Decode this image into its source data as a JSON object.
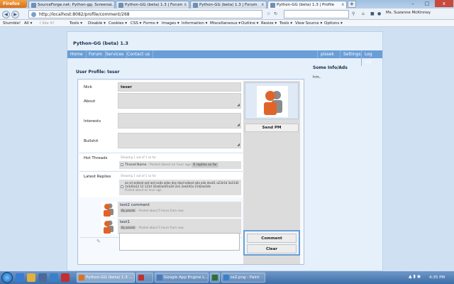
{
  "browser": {
    "app_button": "Firefox",
    "tabs": [
      {
        "label": "SourceForge.net: Python-gg: Screens..."
      },
      {
        "label": "Python-GG (beta) 1.3 | Forum"
      },
      {
        "label": "Python-GG (beta) 1.3 | Forum"
      },
      {
        "label": "Python-GG (beta) 1.3 | Profile"
      }
    ],
    "new_tab": "+",
    "window_controls": {
      "minimize": "–",
      "maximize": "□",
      "close": "x"
    },
    "url": "http://localhost:8082/profile/comment/268",
    "user": "Ms. Suzanne McKinney",
    "bookmarks": [
      {
        "label": "Stumble!"
      },
      {
        "label": "All ▾"
      },
      {
        "label": "I like it!",
        "dim": true
      },
      {
        "label": "Tools ▾"
      },
      {
        "label": "Disable ▾"
      },
      {
        "label": "Cookies ▾"
      },
      {
        "label": "CSS ▾"
      },
      {
        "label": "Forms ▾"
      },
      {
        "label": "Images ▾"
      },
      {
        "label": "Information ▾"
      },
      {
        "label": "Miscellaneous ▾"
      },
      {
        "label": "Outline ▾"
      },
      {
        "label": "Resize ▾"
      },
      {
        "label": "Tools ▾"
      },
      {
        "label": "View Source ▾"
      },
      {
        "label": "Options ▾"
      }
    ]
  },
  "site": {
    "title": "Python-GG (beta) 1.3",
    "nav_left": [
      "Home",
      "Forum",
      "Services",
      "Contact us"
    ],
    "nav_right": [
      "pissek",
      "Settings",
      "Log out"
    ]
  },
  "profile": {
    "heading": "User Profile: teser",
    "nick_label": "Nick",
    "nick_value": "teser",
    "about_label": "About",
    "interests_label": "Interests",
    "bullshit_label": "Bullshit",
    "hot_threads_label": "Hot Threads",
    "hot_threads_meta": "Showing 1 out of 1 so far",
    "thread_name": "Thread Name",
    "thread_posted": "- Posted about an hour ago",
    "thread_replies": "0 replies so far",
    "latest_replies_label": "Latest Replies",
    "latest_replies_meta": "Showing 1 out of 1 so far",
    "reply_text": "ao sd asdasd asd asd asda adas das dasd adasd ada ada dasd1 a23e1d 3a21d2 1a1d2a12 12 121d 32ad2ad21a2d 2a1 2ae2d1a 21d2ae2de",
    "reply_posted": "Posted about an hour ago",
    "comments": [
      {
        "title": "test2 comment",
        "by": "By pissek",
        "posted": "- Posted about 5 hours from now"
      },
      {
        "title": "test1",
        "by": "By pissek",
        "posted": "- Posted about 5 hours from now"
      }
    ],
    "send_pm": "Send PM",
    "comment_button": "Comment",
    "clear_button": "Clear"
  },
  "sidebar": {
    "heading": "Some Info/Ads",
    "text": "hm.."
  },
  "taskbar": {
    "tasks": [
      {
        "label": "Python-GG (beta) 1.3 ...",
        "color": "#e07020",
        "active": true
      },
      {
        "label": "",
        "color": "#c03030",
        "active": false
      },
      {
        "label": "Google App Engine L...",
        "color": "#4a7ab8",
        "active": false
      },
      {
        "label": "",
        "color": "#2f6f2f",
        "active": false
      },
      {
        "label": "ss2.png - Paint",
        "color": "#3a80c8",
        "active": false
      }
    ],
    "clock": "4:35 PM"
  },
  "colors": {
    "nav_blue": "#6a9ed6",
    "avatar_orange": "#e0642a",
    "avatar_gray": "#8a8a8a"
  }
}
